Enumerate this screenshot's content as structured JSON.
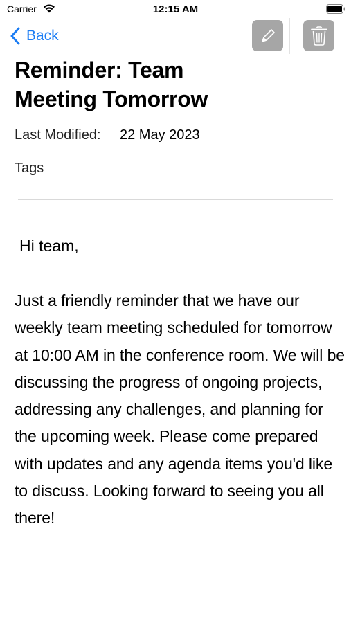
{
  "status_bar": {
    "carrier": "Carrier",
    "time": "12:15 AM",
    "icons": [
      "wifi-icon",
      "battery-icon"
    ]
  },
  "nav": {
    "back_label": "Back",
    "actions": [
      "pencil-icon",
      "trash-icon"
    ],
    "accent_color": "#1a7cf4",
    "action_button_color": "#a6a6a6"
  },
  "note": {
    "title": "Reminder: Team Meeting Tomorrow",
    "last_modified_label": "Last Modified:",
    "last_modified_value": "22 May 2023",
    "tags_label": "Tags",
    "greeting": "Hi team,",
    "body": "Just a friendly reminder that we have our weekly team meeting scheduled for tomorrow at 10:00 AM in the conference room. We will be discussing the progress of ongoing projects, addressing any challenges, and planning for the upcoming week. Please come prepared with updates and any agenda items you'd like to discuss. Looking forward to seeing you all there!"
  }
}
